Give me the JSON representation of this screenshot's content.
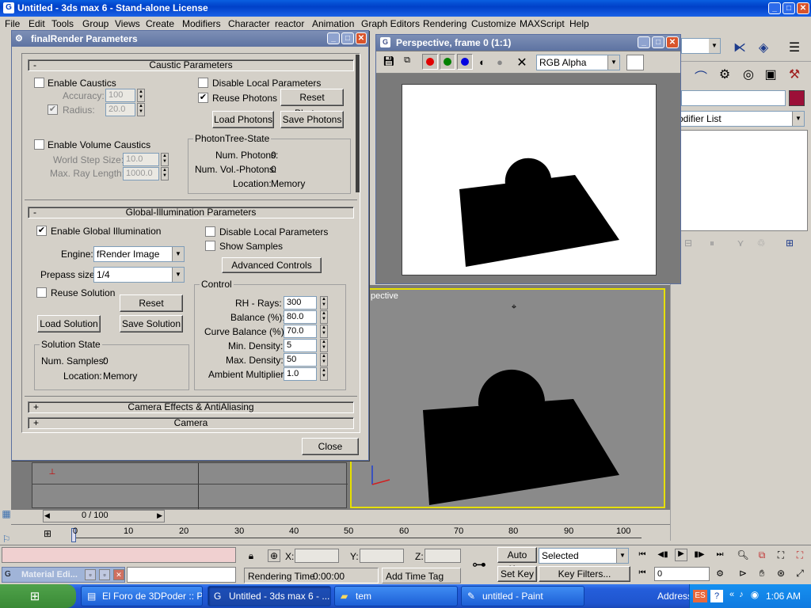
{
  "app": {
    "title": "Untitled - 3ds max 6 - Stand-alone License"
  },
  "menu": [
    "File",
    "Edit",
    "Tools",
    "Group",
    "Views",
    "Create",
    "Modifiers",
    "Character",
    "reactor",
    "Animation",
    "Graph Editors",
    "Rendering",
    "Customize",
    "MAXScript",
    "Help"
  ],
  "dialog": {
    "title": "finalRender Parameters",
    "caustic": {
      "header": "Caustic Parameters",
      "sign": "-",
      "enable_caustics": "Enable Caustics",
      "accuracy_label": "Accuracy:",
      "accuracy": "100",
      "radius_label": "Radius:",
      "radius": "20.0",
      "disable_local": "Disable Local Parameters",
      "reuse_photons": "Reuse Photons",
      "reset_photons": "Reset Photons",
      "load_photons": "Load Photons",
      "save_photons": "Save Photons",
      "enable_volume": "Enable Volume Caustics",
      "world_step_label": "World Step Size:",
      "world_step": "10.0",
      "max_ray_label": "Max. Ray Length:",
      "max_ray": "1000.0",
      "photontree": {
        "title": "PhotonTree-State",
        "num_photons_label": "Num. Photons:",
        "num_photons": "0",
        "num_vol_label": "Num. Vol.-Photons:",
        "num_vol": "0",
        "location_label": "Location:",
        "location": "Memory"
      }
    },
    "gi": {
      "header": "Global-Illumination Parameters",
      "sign": "-",
      "enable_gi": "Enable Global Illumination",
      "disable_local": "Disable Local Parameters",
      "show_samples": "Show Samples",
      "engine_label": "Engine:",
      "engine": "fRender Image",
      "prepass_label": "Prepass size:",
      "prepass": "1/4",
      "advanced": "Advanced Controls",
      "reuse_solution": "Reuse Solution",
      "reset_solution": "Reset Solution",
      "load_solution": "Load Solution",
      "save_solution": "Save Solution",
      "solution_state": {
        "title": "Solution State",
        "num_samples_label": "Num. Samples:",
        "num_samples": "0",
        "location_label": "Location:",
        "location": "Memory"
      },
      "control": {
        "title": "Control",
        "rh_label": "RH - Rays:",
        "rh": "300",
        "balance_label": "Balance (%):",
        "balance": "80.0",
        "curve_label": "Curve Balance (%):",
        "curve": "70.0",
        "min_label": "Min. Density:",
        "min": "5",
        "max_label": "Max. Density:",
        "max": "50",
        "ambient_label": "Ambient Multiplier:",
        "ambient": "1.0"
      }
    },
    "camera_effects": {
      "header": "Camera Effects & AntiAliasing",
      "sign": "+"
    },
    "camera": {
      "header": "Camera",
      "sign": "+"
    },
    "close": "Close"
  },
  "render_window": {
    "title": "Perspective, frame 0 (1:1)",
    "channel": "RGB Alpha",
    "channel_colors": {
      "red": "#e00000",
      "green": "#008000",
      "blue": "#0000e0"
    }
  },
  "viewport": {
    "label": "pective"
  },
  "right_panel": {
    "modifier_list": "odifier List",
    "color_swatch": "#9c1038"
  },
  "timeline": {
    "frame": "0 / 100",
    "ticks": [
      "0",
      "10",
      "20",
      "30",
      "40",
      "50",
      "60",
      "70",
      "80",
      "90",
      "100"
    ]
  },
  "status": {
    "x_label": "X:",
    "y_label": "Y:",
    "z_label": "Z:",
    "auto_key": "Auto Key",
    "selected": "Selected",
    "set_key": "Set Key",
    "key_filters": "Key Filters...",
    "frame_value": "0",
    "rendering_time_label": "Rendering Time",
    "rendering_time": "0:00:00",
    "add_time_tag": "Add Time Tag",
    "material_editor": "Material Edi..."
  },
  "taskbar": {
    "items": [
      "El Foro de 3DPoder :: P...",
      "Untitled - 3ds max 6 - ...",
      "tem",
      "untitled - Paint"
    ],
    "address": "Address",
    "lang": "ES",
    "time": "1:06 AM"
  }
}
